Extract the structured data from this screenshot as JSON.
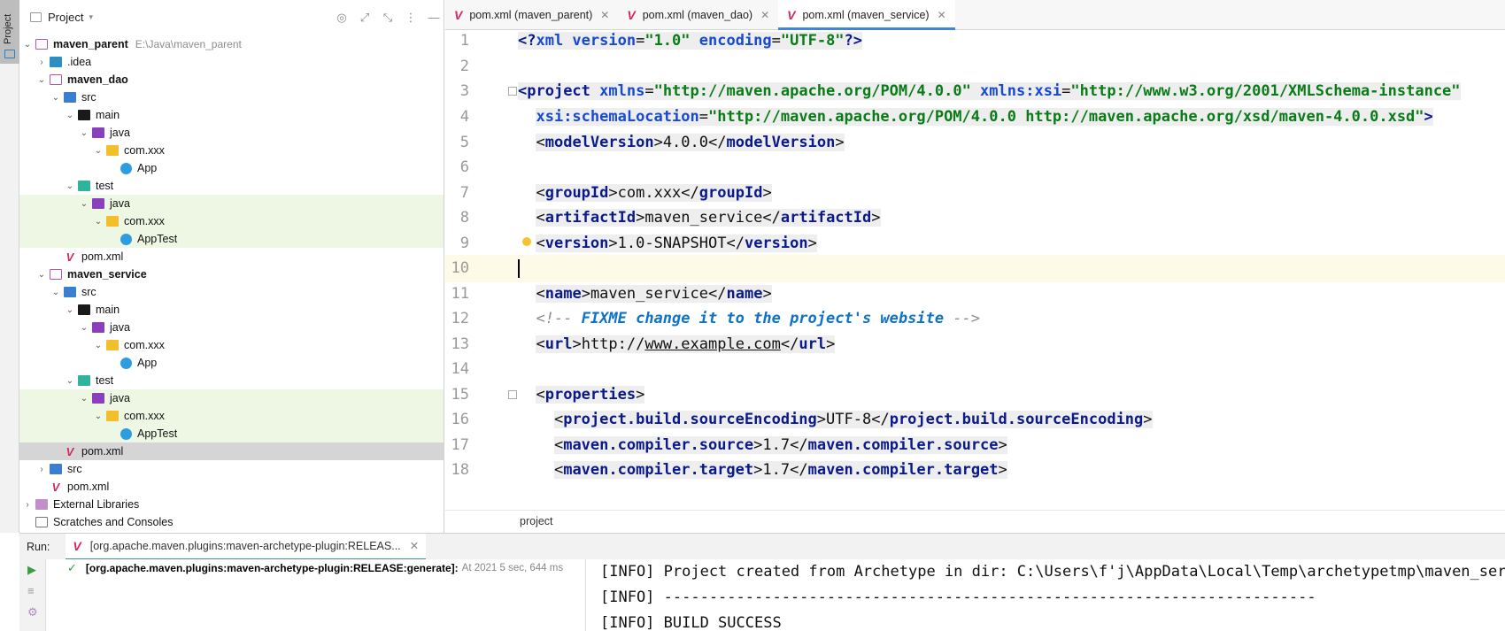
{
  "sidebar_strip": {
    "project_tab_label": "Project"
  },
  "project_panel": {
    "title": "Project",
    "tree": [
      {
        "label": "maven_parent",
        "path": "E:\\Java\\maven_parent"
      },
      {
        "label": ".idea"
      },
      {
        "label": "maven_dao"
      },
      {
        "label": "src"
      },
      {
        "label": "main"
      },
      {
        "label": "java"
      },
      {
        "label": "com.xxx"
      },
      {
        "label": "App"
      },
      {
        "label": "test"
      },
      {
        "label": "java"
      },
      {
        "label": "com.xxx"
      },
      {
        "label": "AppTest"
      },
      {
        "label": "pom.xml"
      },
      {
        "label": "maven_service"
      },
      {
        "label": "src"
      },
      {
        "label": "main"
      },
      {
        "label": "java"
      },
      {
        "label": "com.xxx"
      },
      {
        "label": "App"
      },
      {
        "label": "test"
      },
      {
        "label": "java"
      },
      {
        "label": "com.xxx"
      },
      {
        "label": "AppTest"
      },
      {
        "label": "pom.xml"
      },
      {
        "label": "src"
      },
      {
        "label": "pom.xml"
      },
      {
        "label": "External Libraries"
      },
      {
        "label": "Scratches and Consoles"
      }
    ]
  },
  "editor_tabs": [
    {
      "label": "pom.xml (maven_parent)"
    },
    {
      "label": "pom.xml (maven_dao)"
    },
    {
      "label": "pom.xml (maven_service)"
    }
  ],
  "editor": {
    "line_numbers": [
      "1",
      "2",
      "3",
      "4",
      "5",
      "6",
      "7",
      "8",
      "9",
      "10",
      "11",
      "12",
      "13",
      "14",
      "15",
      "16",
      "17",
      "18"
    ],
    "l1": {
      "a": "<?",
      "b": "xml version",
      "c": "=",
      "d": "\"1.0\"",
      "e": " encoding",
      "f": "=",
      "g": "\"UTF-8\"",
      "h": "?>"
    },
    "l3": {
      "a": "<",
      "b": "project",
      "c": " xmlns",
      "d": "=",
      "e": "\"http://maven.apache.org/POM/4.0.0\"",
      "f": " xmlns:xsi",
      "g": "=",
      "h": "\"http://www.w3.org/2001/XMLSchema-instance\""
    },
    "l4": {
      "a": "xsi:schemaLocation",
      "b": "=",
      "c": "\"http://maven.apache.org/POM/4.0.0 http://maven.apache.org/xsd/maven-4.0.0.xsd\"",
      "d": ">"
    },
    "l5": {
      "tag": "modelVersion",
      "value": "4.0.0"
    },
    "l7": {
      "tag": "groupId",
      "value": "com.xxx"
    },
    "l8": {
      "tag": "artifactId",
      "value": "maven_service"
    },
    "l9": {
      "tag": "version",
      "value": "1.0-SNAPSHOT"
    },
    "l11": {
      "tag": "name",
      "value": "maven_service"
    },
    "l12": {
      "open": "<!-- ",
      "todo": "FIXME change it to the project's website",
      "close": " -->"
    },
    "l13": {
      "tag": "url",
      "value_a": "http://",
      "value_b": "www.example.com"
    },
    "l15": {
      "tag": "properties"
    },
    "l16": {
      "tag": "project.build.sourceEncoding",
      "value": "UTF-8"
    },
    "l17": {
      "tag": "maven.compiler.source",
      "value": "1.7"
    },
    "l18": {
      "tag": "maven.compiler.target",
      "value": "1.7"
    }
  },
  "breadcrumb": "project",
  "run": {
    "label": "Run:",
    "tab_label": "[org.apache.maven.plugins:maven-archetype-plugin:RELEAS...",
    "item_label": "[org.apache.maven.plugins:maven-archetype-plugin:RELEASE:generate]:",
    "item_time": "At 2021 5 sec, 644 ms",
    "console": [
      "[INFO] Project created from Archetype in dir: C:\\Users\\f'j\\AppData\\Local\\Temp\\archetypetmp\\maven_service",
      "[INFO] ------------------------------------------------------------------------",
      "[INFO] BUILD SUCCESS"
    ]
  },
  "colors": {
    "accent": "#3f86d9",
    "maven": "#d2285c",
    "tag": "#0a1a8a",
    "string": "#097b17",
    "current_line": "#fdfbe7",
    "test_highlight": "#eef7e4"
  }
}
